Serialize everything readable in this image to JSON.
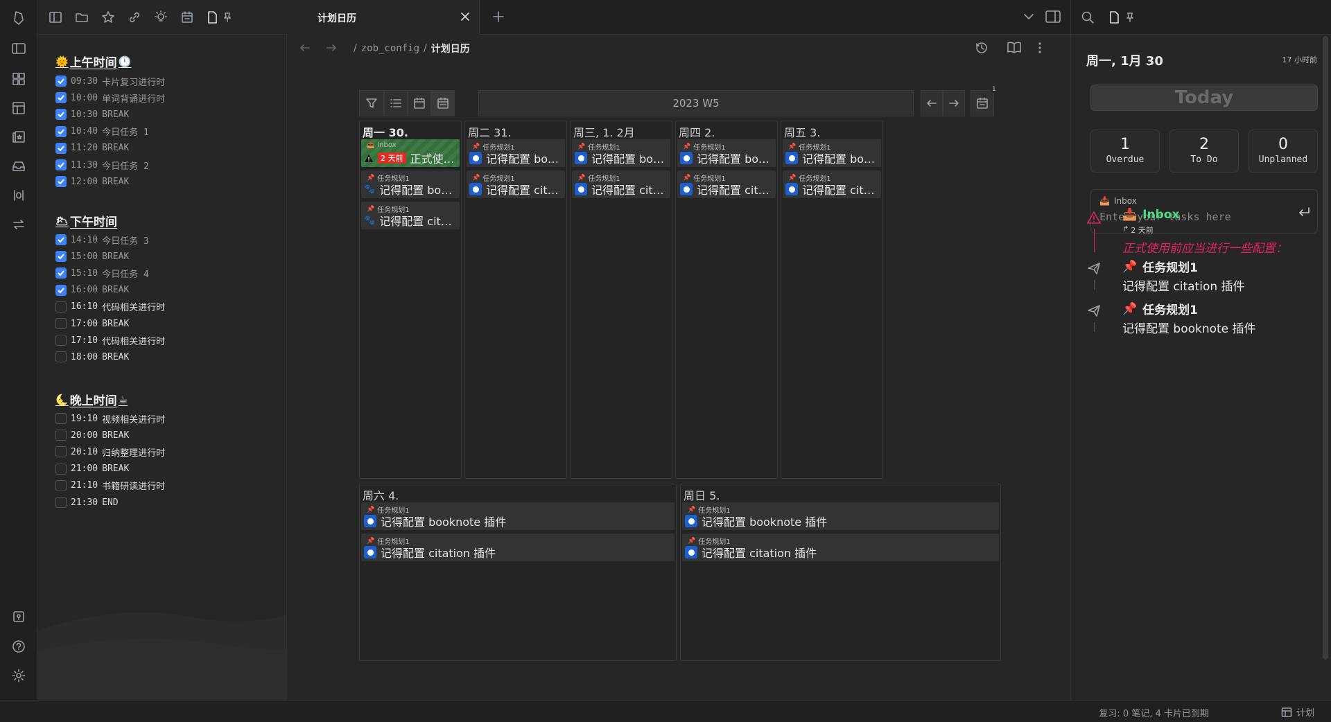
{
  "left_panel": {
    "morning": {
      "title": "上午时间",
      "tasks": [
        {
          "time": "09:30",
          "text": "卡片复习进行时",
          "done": true
        },
        {
          "time": "10:00",
          "text": "单词背诵进行时",
          "done": true
        },
        {
          "time": "10:30",
          "text": "BREAK",
          "done": true
        },
        {
          "time": "10:40",
          "text": "今日任务 1",
          "done": true
        },
        {
          "time": "11:20",
          "text": "BREAK",
          "done": true
        },
        {
          "time": "11:30",
          "text": "今日任务 2",
          "done": true
        },
        {
          "time": "12:00",
          "text": "BREAK",
          "done": true
        }
      ]
    },
    "afternoon": {
      "title": "下午时间",
      "tasks": [
        {
          "time": "14:10",
          "text": "今日任务 3",
          "done": true
        },
        {
          "time": "15:00",
          "text": "BREAK",
          "done": true
        },
        {
          "time": "15:10",
          "text": "今日任务 4",
          "done": true
        },
        {
          "time": "16:00",
          "text": "BREAK",
          "done": true
        },
        {
          "time": "16:10",
          "text": "代码相关进行时",
          "done": false
        },
        {
          "time": "17:00",
          "text": "BREAK",
          "done": false
        },
        {
          "time": "17:10",
          "text": "代码相关进行时",
          "done": false
        },
        {
          "time": "18:00",
          "text": "BREAK",
          "done": false
        }
      ]
    },
    "evening": {
      "title": "晚上时间",
      "tasks": [
        {
          "time": "19:10",
          "text": "视频相关进行时",
          "done": false
        },
        {
          "time": "20:00",
          "text": "BREAK",
          "done": false
        },
        {
          "time": "20:10",
          "text": "归纳整理进行时",
          "done": false
        },
        {
          "time": "21:00",
          "text": "BREAK",
          "done": false
        },
        {
          "time": "21:10",
          "text": "书籍研读进行时",
          "done": false
        },
        {
          "time": "21:30",
          "text": "END",
          "done": false
        }
      ]
    }
  },
  "tab": {
    "title": "计划日历"
  },
  "breadcrumb": {
    "sep": "/",
    "folder": "zob_config",
    "current": "计划日历"
  },
  "calendar": {
    "week_label": "2023 W5",
    "badge_count": "1",
    "days": [
      {
        "label": "周一 30.",
        "cards": [
          {
            "project": "Inbox",
            "text": "正式使用前应当进行一些配置：",
            "overdue": "2 天前",
            "kind": "inbox"
          },
          {
            "project": "任务规划1",
            "text": "记得配置 booknote 插件",
            "kind": "done"
          },
          {
            "project": "任务规划1",
            "text": "记得配置 citation 插件",
            "kind": "done"
          }
        ]
      },
      {
        "label": "周二 31.",
        "cards": [
          {
            "project": "任务规划1",
            "text": "记得配置 booknote 插件",
            "kind": "todo"
          },
          {
            "project": "任务规划1",
            "text": "记得配置 citation 插件",
            "kind": "todo"
          }
        ]
      },
      {
        "label": "周三, 1. 2月",
        "cards": [
          {
            "project": "任务规划1",
            "text": "记得配置 booknote 插件",
            "kind": "todo"
          },
          {
            "project": "任务规划1",
            "text": "记得配置 citation 插件",
            "kind": "todo"
          }
        ]
      },
      {
        "label": "周四 2.",
        "cards": [
          {
            "project": "任务规划1",
            "text": "记得配置 booknote 插件",
            "kind": "todo"
          },
          {
            "project": "任务规划1",
            "text": "记得配置 citation 插件",
            "kind": "todo"
          }
        ]
      },
      {
        "label": "周五 3.",
        "cards": [
          {
            "project": "任务规划1",
            "text": "记得配置 booknote 插件",
            "kind": "todo"
          },
          {
            "project": "任务规划1",
            "text": "记得配置 citation 插件",
            "kind": "todo"
          }
        ]
      },
      {
        "label": "周六 4.",
        "cards": [
          {
            "project": "任务规划1",
            "text": "记得配置 booknote 插件",
            "kind": "todo"
          },
          {
            "project": "任务规划1",
            "text": "记得配置 citation 插件",
            "kind": "todo"
          }
        ]
      },
      {
        "label": "周日 5.",
        "cards": [
          {
            "project": "任务规划1",
            "text": "记得配置 booknote 插件",
            "kind": "todo"
          },
          {
            "project": "任务规划1",
            "text": "记得配置 citation 插件",
            "kind": "todo"
          }
        ]
      }
    ]
  },
  "right_panel": {
    "date": "周一, 1月 30",
    "ago": "17 小时前",
    "today_label": "Today",
    "stats": [
      {
        "value": "1",
        "label": "Overdue"
      },
      {
        "value": "2",
        "label": "To Do"
      },
      {
        "value": "0",
        "label": "Unplanned"
      }
    ],
    "quick_add": {
      "project": "Inbox",
      "placeholder": "Enter your tasks here"
    },
    "agenda": [
      {
        "title": "Inbox",
        "meta": "2 天前",
        "text": "正式使用前应当进行一些配置："
      },
      {
        "title": "任务规划1",
        "text": "记得配置 citation 插件"
      },
      {
        "title": "任务规划1",
        "text": "记得配置 booknote 插件"
      }
    ]
  },
  "statusbar": {
    "review": "复习: 0 笔记, 4 卡片已到期",
    "plan": "计划"
  },
  "colors": {
    "accent": "#3b82f6",
    "inbox_green": "#4ade80",
    "danger": "#e0245e"
  }
}
